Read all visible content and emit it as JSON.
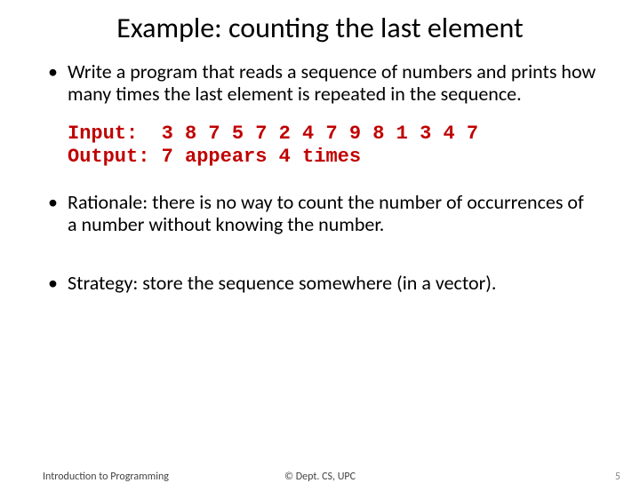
{
  "title": "Example: counting the last element",
  "bullets": {
    "b0": "Write a program that reads a sequence of numbers and prints how many times the last element is repeated in the sequence.",
    "b1": "Rationale: there is no way to count the number of occurrences of a number without knowing the number.",
    "b2": "Strategy: store the sequence somewhere (in a vector)."
  },
  "code": {
    "line1": "Input:  3 8 7 5 7 2 4 7 9 8 1 3 4 7",
    "line2": "Output: 7 appears 4 times"
  },
  "footer": {
    "left": "Introduction to Programming",
    "center": "© Dept. CS, UPC",
    "right": "5"
  }
}
